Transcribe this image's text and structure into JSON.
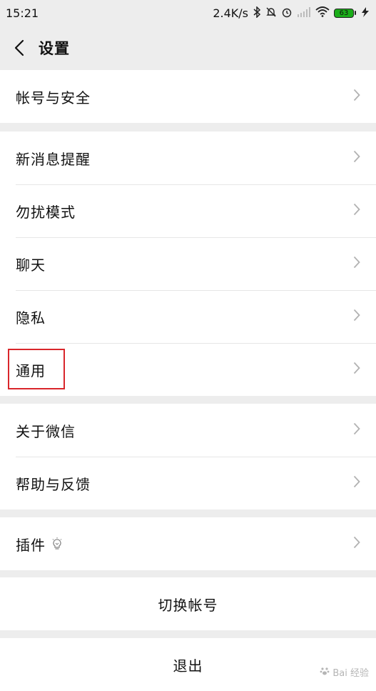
{
  "status_bar": {
    "time": "15:21",
    "speed": "2.4K/s",
    "battery": "63",
    "icons": [
      "bluetooth-icon",
      "mute-icon",
      "alarm-icon",
      "signal-icon",
      "wifi-icon",
      "battery-icon",
      "charging-icon"
    ]
  },
  "nav": {
    "title": "设置"
  },
  "groups": [
    {
      "items": [
        {
          "label": "帐号与安全"
        }
      ]
    },
    {
      "items": [
        {
          "label": "新消息提醒"
        },
        {
          "label": "勿扰模式"
        },
        {
          "label": "聊天"
        },
        {
          "label": "隐私"
        },
        {
          "label": "通用"
        }
      ]
    },
    {
      "items": [
        {
          "label": "关于微信"
        },
        {
          "label": "帮助与反馈"
        }
      ]
    },
    {
      "items": [
        {
          "label": "插件"
        }
      ]
    }
  ],
  "actions": {
    "switch_account": "切换帐号",
    "logout": "退出"
  },
  "watermark": "Bai 经验",
  "colors": {
    "background": "#ededed",
    "row": "#ffffff",
    "highlight": "#d9262b"
  }
}
